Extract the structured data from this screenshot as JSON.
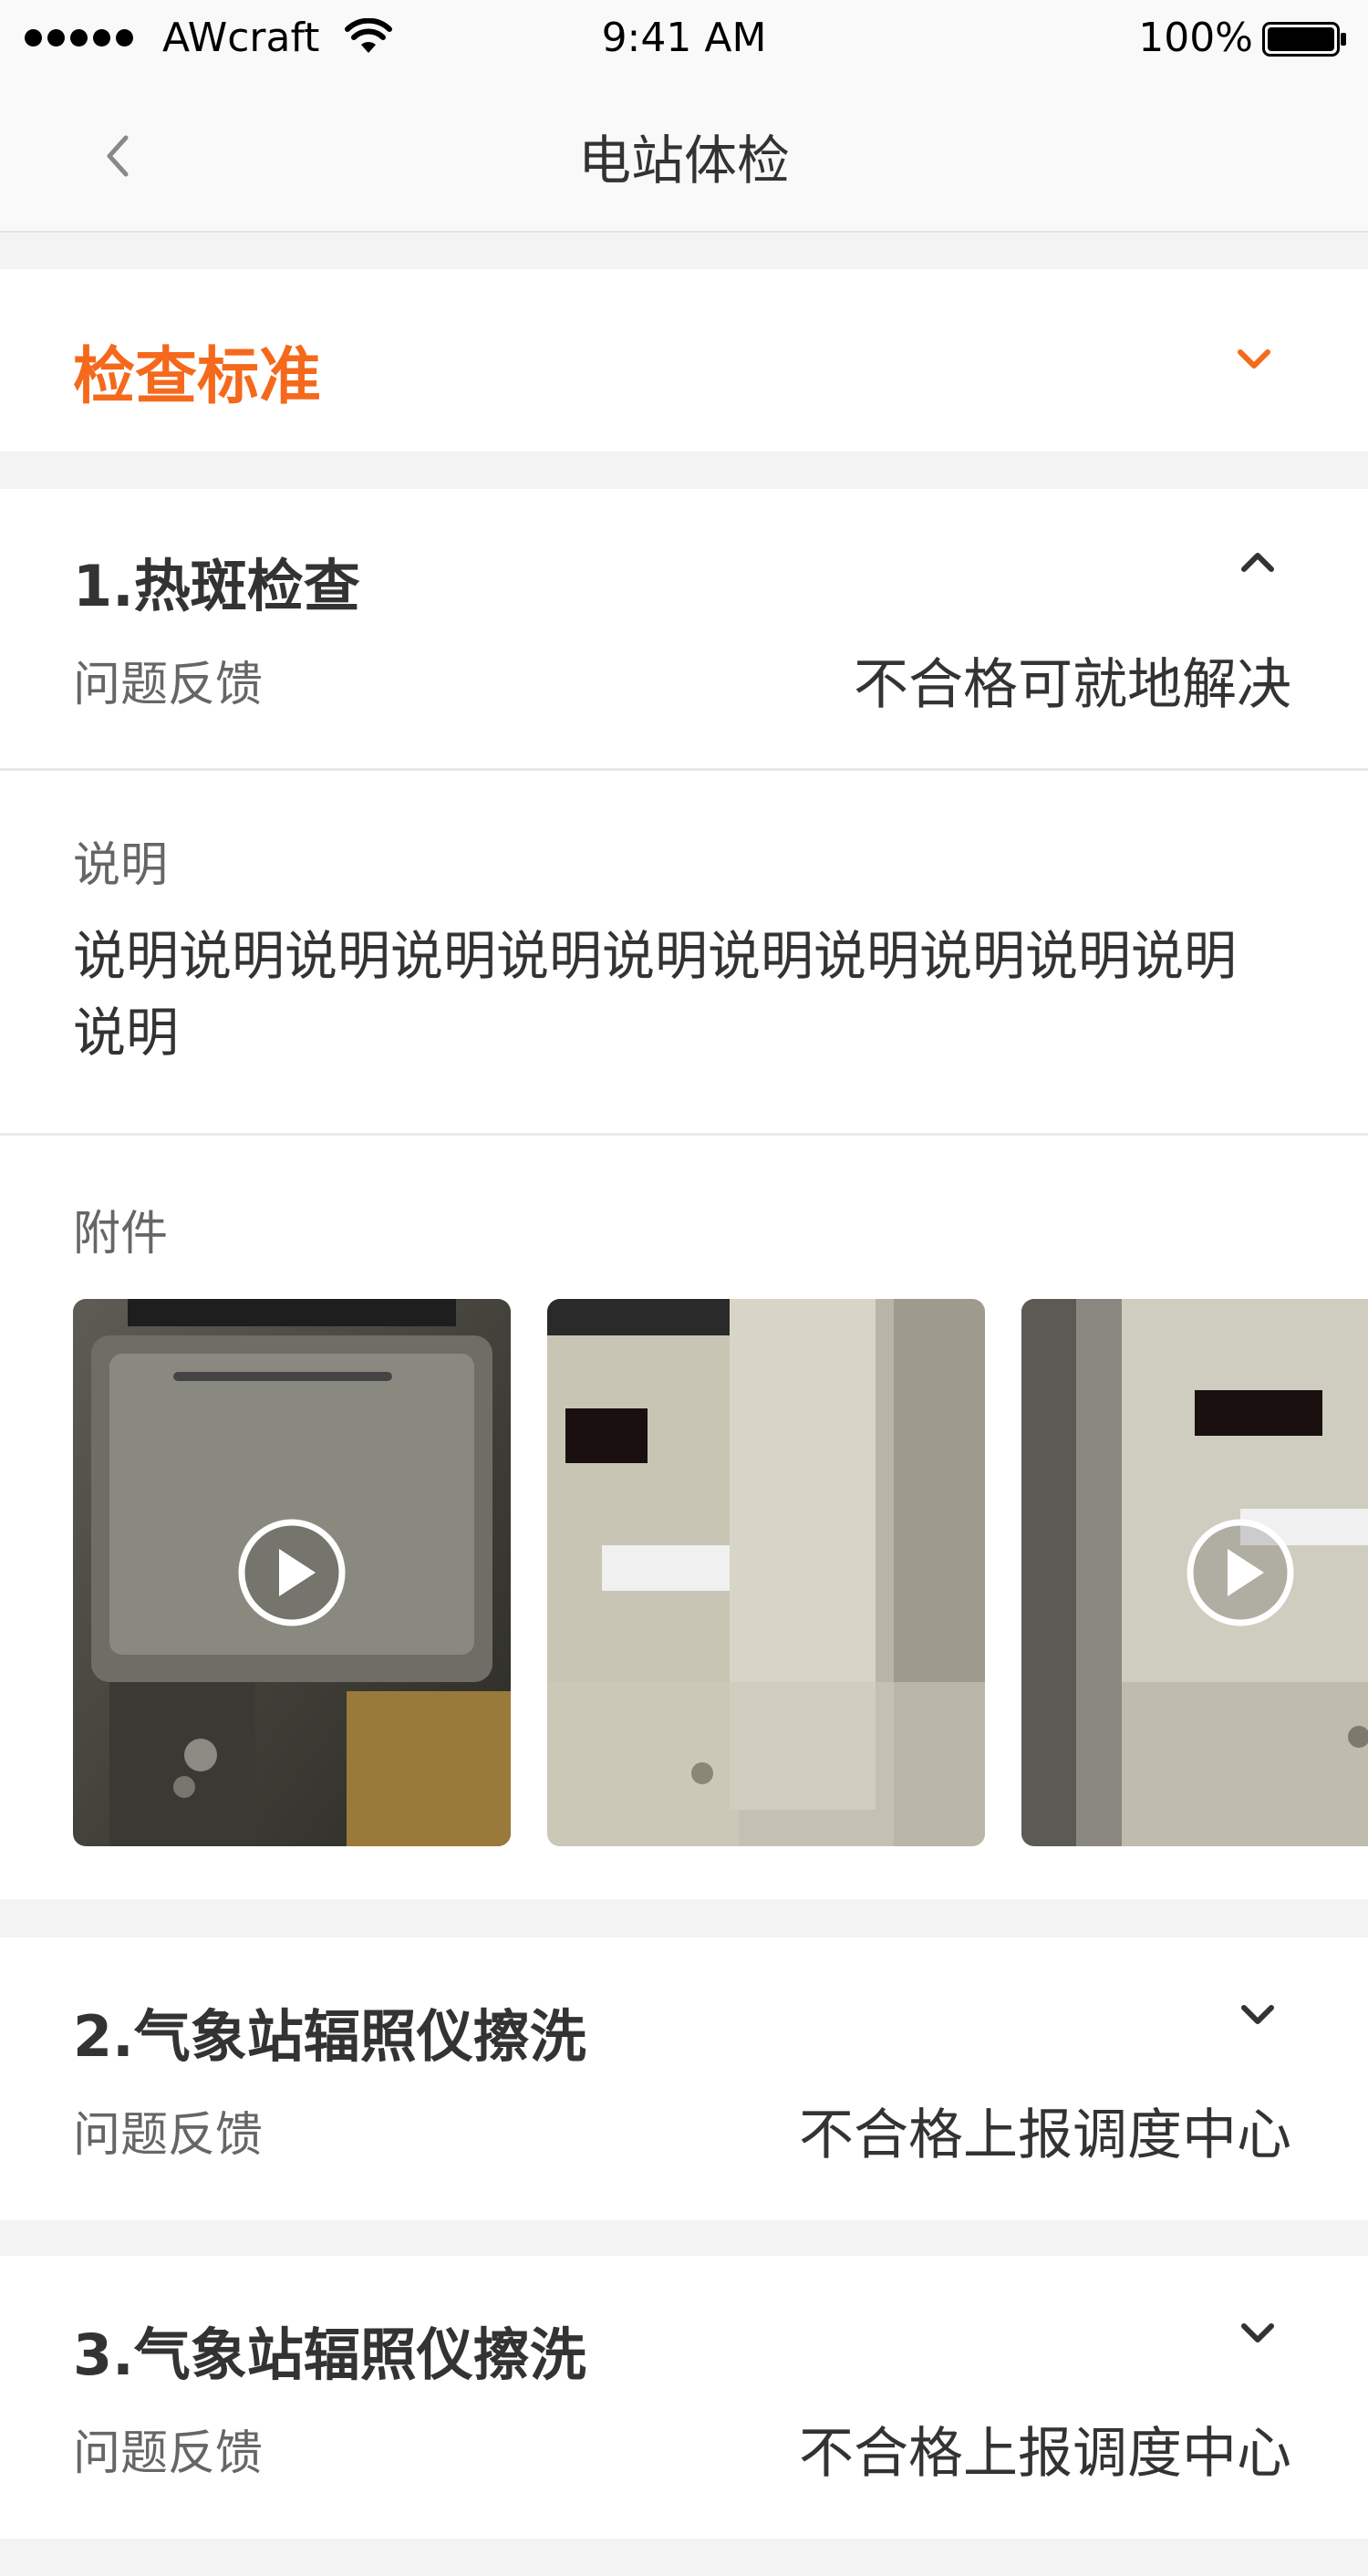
{
  "status_bar": {
    "carrier": "AWcraft",
    "time": "9:41 AM",
    "battery": "100%"
  },
  "nav": {
    "title": "电站体检",
    "back_icon": "chevron-left-icon"
  },
  "standard": {
    "title": "检查标准",
    "accent_color": "#f5691c",
    "toggle_icon": "chevron-down-icon"
  },
  "items": [
    {
      "title": "1.热斑检查",
      "feedback_label": "问题反馈",
      "feedback_value": "不合格可就地解决",
      "expanded": true,
      "toggle_icon": "chevron-up-icon",
      "description_label": "说明",
      "description": "说明说明说明说明说明说明说明说明说明说明说明说明",
      "attachments_label": "附件",
      "attachments": [
        {
          "type": "video",
          "icon": "play-icon"
        },
        {
          "type": "image"
        },
        {
          "type": "video",
          "icon": "play-icon"
        }
      ]
    },
    {
      "title": "2.气象站辐照仪擦洗",
      "feedback_label": "问题反馈",
      "feedback_value": "不合格上报调度中心",
      "expanded": false,
      "toggle_icon": "chevron-down-icon"
    },
    {
      "title": "3.气象站辐照仪擦洗",
      "feedback_label": "问题反馈",
      "feedback_value": "不合格上报调度中心",
      "expanded": false,
      "toggle_icon": "chevron-down-icon"
    }
  ]
}
